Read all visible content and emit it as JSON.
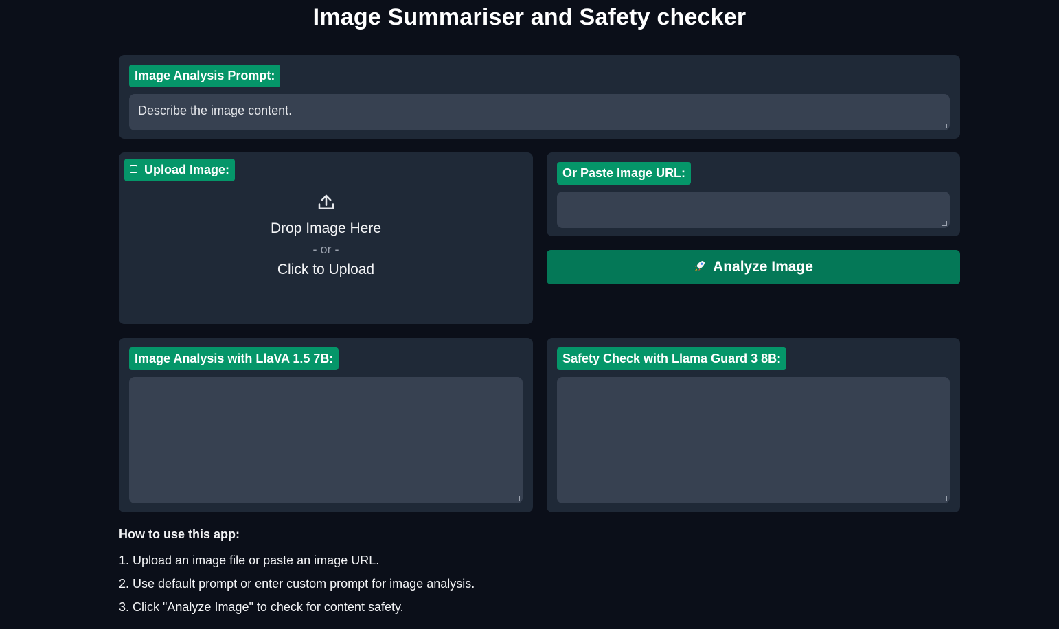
{
  "app": {
    "title": "Image Summariser and Safety checker"
  },
  "prompt": {
    "label": "Image Analysis Prompt:",
    "value": "Describe the image content."
  },
  "upload": {
    "label": "Upload Image:",
    "drop_text": "Drop Image Here",
    "or_text": "- or -",
    "click_text": "Click to Upload",
    "icon": "upload-icon"
  },
  "url": {
    "label": "Or Paste Image URL:",
    "value": ""
  },
  "analyze": {
    "label": "Analyze Image",
    "icon": "rocket-icon"
  },
  "analysis": {
    "label": "Image Analysis with LlaVA 1.5 7B:",
    "value": ""
  },
  "safety": {
    "label": "Safety Check with Llama Guard 3 8B:",
    "value": ""
  },
  "howto": {
    "heading": "How to use this app:",
    "steps": [
      "1. Upload an image file or paste an image URL.",
      "2. Use default prompt or enter custom prompt for image analysis.",
      "3. Click \"Analyze Image\" to check for content safety."
    ]
  },
  "colors": {
    "background": "#0b0f19",
    "panel": "#1f2937",
    "input": "#374151",
    "accent": "#059669",
    "button": "#047857"
  }
}
